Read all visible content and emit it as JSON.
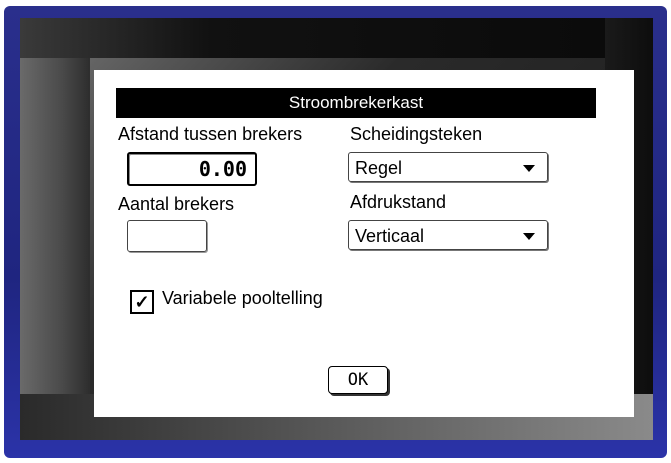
{
  "dialog": {
    "title": "Stroombrekerkast",
    "distance_label": "Afstand tussen brekers",
    "distance_value": "0.00",
    "count_label": "Aantal brekers",
    "count_value": "",
    "separator_label": "Scheidingsteken",
    "separator_value": "Regel",
    "orientation_label": "Afdrukstand",
    "orientation_value": "Verticaal",
    "variable_pole_label": "Variabele pooltelling",
    "variable_pole_checked": true,
    "checkmark_glyph": "✓",
    "ok_label": "OK"
  },
  "icons": {
    "dropdown_arrow": "chevron-down-icon",
    "checkmark": "checkmark-icon"
  },
  "colors": {
    "device_frame": "#2a2f8c",
    "title_bar": "#000000",
    "dialog_background": "#ffffff"
  }
}
